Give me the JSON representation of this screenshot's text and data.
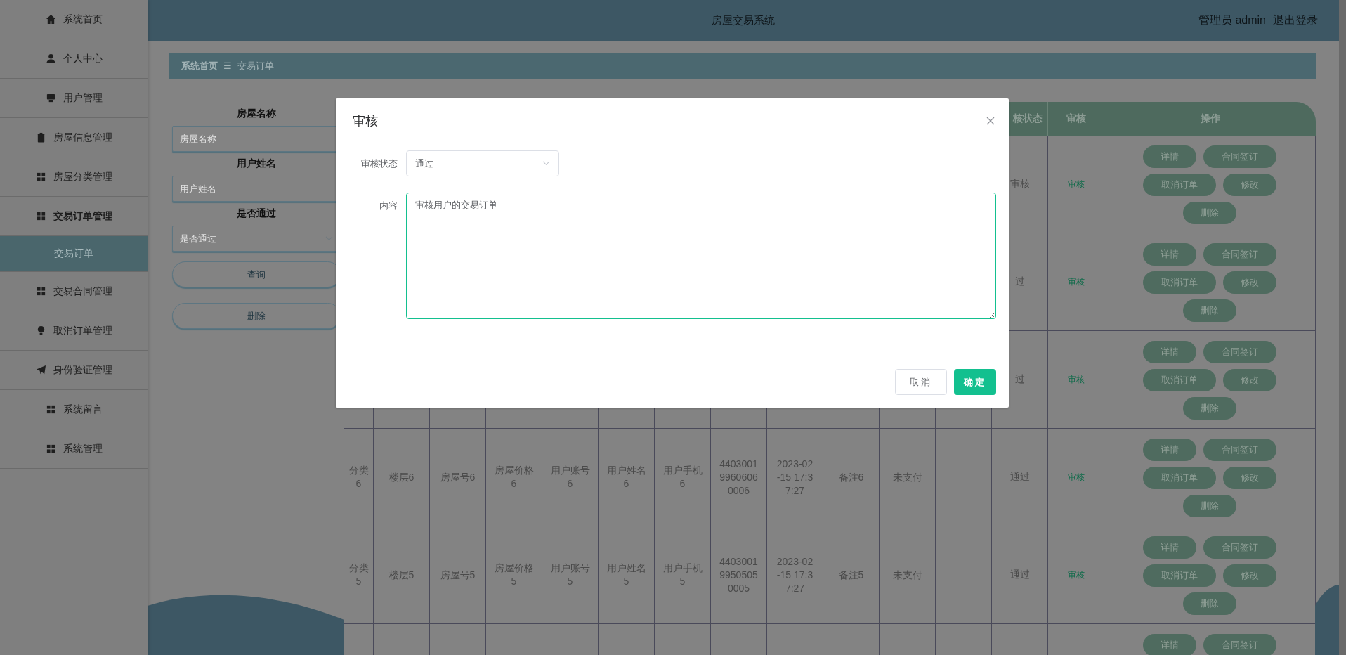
{
  "sidebar": {
    "items": [
      {
        "label": "系统首页",
        "selected": false
      },
      {
        "label": "个人中心",
        "selected": false
      },
      {
        "label": "用户管理",
        "selected": false
      },
      {
        "label": "房屋信息管理",
        "selected": false
      },
      {
        "label": "房屋分类管理",
        "selected": false
      },
      {
        "label": "交易订单管理",
        "selected": false,
        "expanded": true,
        "children": [
          {
            "label": "交易订单",
            "selected": true
          }
        ]
      },
      {
        "label": "交易合同管理",
        "selected": false
      },
      {
        "label": "取消订单管理",
        "selected": false
      },
      {
        "label": "身份验证管理",
        "selected": false
      },
      {
        "label": "系统留言",
        "selected": false
      },
      {
        "label": "系统管理",
        "selected": false
      }
    ]
  },
  "header": {
    "title": "房屋交易系统",
    "user": "管理员 admin",
    "logout": "退出登录"
  },
  "breadcrumb": {
    "items": [
      "系统首页",
      "交易订单"
    ],
    "separator": "☰"
  },
  "search": {
    "fields": [
      {
        "kind": "input",
        "label": "房屋名称",
        "placeholder": "房屋名称"
      },
      {
        "kind": "input",
        "label": "用户姓名",
        "placeholder": "用户姓名"
      },
      {
        "kind": "select",
        "label": "是否通过",
        "placeholder": "是否通过"
      }
    ],
    "buttons": [
      "查询",
      "删除"
    ]
  },
  "table": {
    "columns": [
      "核状态",
      "审核",
      "操作"
    ],
    "rows": [
      {
        "status": "审核",
        "audit": "审核",
        "actions": [
          "详情",
          "合同签订",
          "取消订单",
          "修改",
          "删除"
        ]
      },
      {
        "status": "过",
        "audit": "审核",
        "actions": [
          "详情",
          "合同签订",
          "取消订单",
          "修改",
          "删除"
        ]
      },
      {
        "status": "过",
        "audit": "审核",
        "actions": [
          "详情",
          "合同签订",
          "取消订单",
          "修改",
          "删除"
        ]
      },
      {
        "cells": [
          "分类6",
          "楼层6",
          "房屋号6",
          "房屋价格6",
          "用户账号6",
          "用户姓名6",
          "用户手机6",
          "440300199606060006",
          "2023-02-15 17:37:27",
          "备注6",
          "未支付"
        ],
        "status": "通过",
        "audit": "审核",
        "actions": [
          "详情",
          "合同签订",
          "取消订单",
          "修改",
          "删除"
        ]
      },
      {
        "cells": [
          "分类5",
          "楼层5",
          "房屋号5",
          "房屋价格5",
          "用户账号5",
          "用户姓名5",
          "用户手机5",
          "440300199505050005",
          "2023-02-15 17:37:27",
          "备注5",
          "未支付"
        ],
        "status": "通过",
        "audit": "审核",
        "actions": [
          "详情",
          "合同签订",
          "取消订单",
          "修改",
          "删除"
        ]
      },
      {
        "actions": [
          "详情",
          "合同签订"
        ]
      }
    ]
  },
  "dialog": {
    "title": "审核",
    "fields": [
      {
        "kind": "select",
        "label": "审核状态",
        "value": "通过"
      },
      {
        "kind": "textarea",
        "label": "内容",
        "value": "审核用户的交易订单",
        "focused": true
      }
    ],
    "buttons": [
      {
        "label": "取消",
        "kind": "plain"
      },
      {
        "label": "确定",
        "kind": "primary"
      }
    ]
  }
}
